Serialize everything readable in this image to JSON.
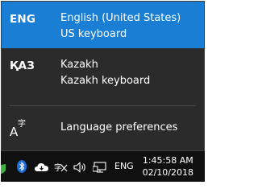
{
  "languages": [
    {
      "code": "ENG",
      "name": "English (United States)",
      "keyboard": "US keyboard",
      "selected": true
    },
    {
      "code": "ҚАЗ",
      "name": "Kazakh",
      "keyboard": "Kazakh keyboard",
      "selected": false
    }
  ],
  "preferences": {
    "label": "Language preferences",
    "icon": "language-icon"
  },
  "taskbar": {
    "input_indicator": "ENG",
    "time": "1:45:58 AM",
    "date": "02/10/2018"
  },
  "colors": {
    "accent": "#1a7ed4",
    "flyout_bg": "#2b2b2b",
    "taskbar_bg": "#101010"
  }
}
